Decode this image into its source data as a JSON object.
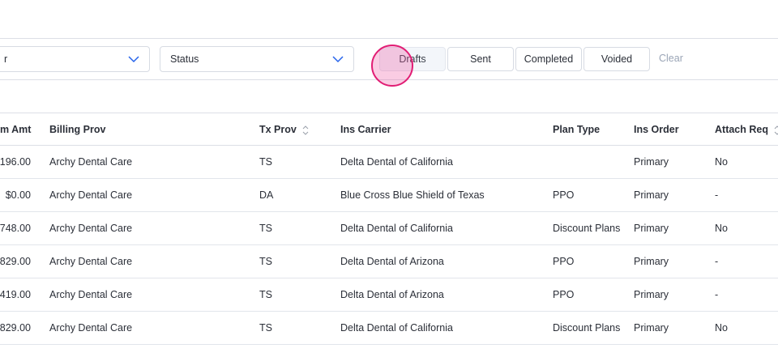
{
  "filters": {
    "select_a_value": "r",
    "status_placeholder": "Status",
    "tabs": [
      "Drafts",
      "Sent",
      "Completed",
      "Voided"
    ],
    "clear_label": "Clear"
  },
  "table": {
    "headers": {
      "amount": "m Amt",
      "billing": "Billing Prov",
      "tx": "Tx Prov",
      "carrier": "Ins Carrier",
      "plan": "Plan Type",
      "order": "Ins Order",
      "attach": "Attach Req"
    },
    "rows": [
      {
        "amount": "196.00",
        "billing": "Archy Dental Care",
        "tx": "TS",
        "carrier": "Delta Dental of California",
        "plan": "",
        "order": "Primary",
        "attach": "No"
      },
      {
        "amount": "$0.00",
        "billing": "Archy Dental Care",
        "tx": "DA",
        "carrier": "Blue Cross Blue Shield of Texas",
        "plan": "PPO",
        "order": "Primary",
        "attach": "-"
      },
      {
        "amount": "748.00",
        "billing": "Archy Dental Care",
        "tx": "TS",
        "carrier": "Delta Dental of California",
        "plan": "Discount Plans",
        "order": "Primary",
        "attach": "No"
      },
      {
        "amount": "829.00",
        "billing": "Archy Dental Care",
        "tx": "TS",
        "carrier": "Delta Dental of Arizona",
        "plan": "PPO",
        "order": "Primary",
        "attach": "-"
      },
      {
        "amount": "419.00",
        "billing": "Archy Dental Care",
        "tx": "TS",
        "carrier": "Delta Dental of Arizona",
        "plan": "PPO",
        "order": "Primary",
        "attach": "-"
      },
      {
        "amount": "829.00",
        "billing": "Archy Dental Care",
        "tx": "TS",
        "carrier": "Delta Dental of California",
        "plan": "Discount Plans",
        "order": "Primary",
        "attach": "No"
      }
    ]
  },
  "colors": {
    "accent": "#2563eb",
    "cursor": "#e11d74",
    "border": "#dcdfe6",
    "muted": "#9aa5b6"
  },
  "icons": [
    "chevron-down-icon",
    "sort-icon"
  ]
}
